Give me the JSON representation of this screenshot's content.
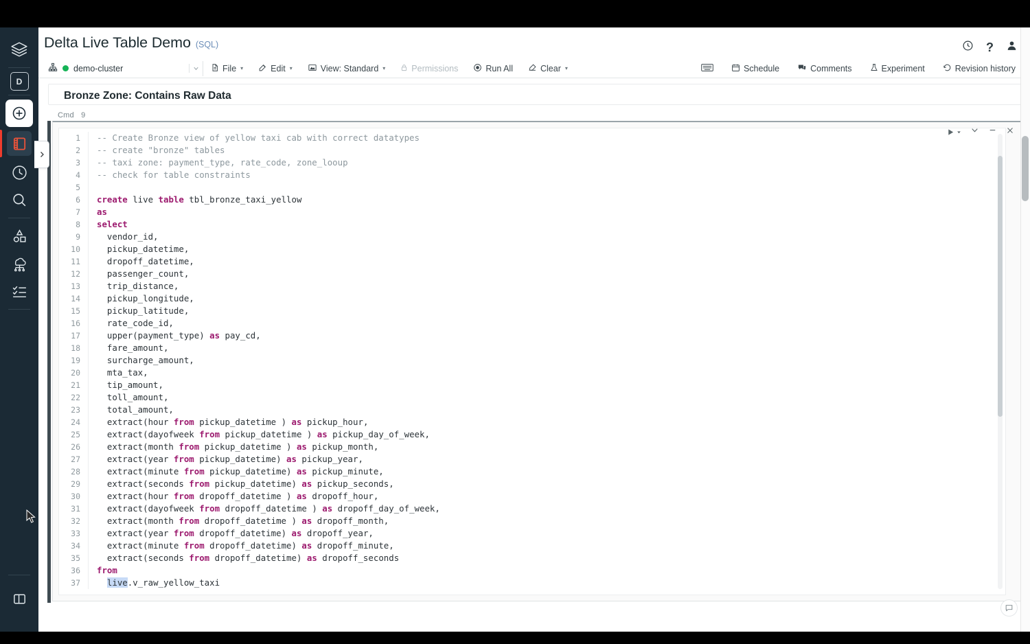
{
  "header": {
    "title": "Delta Live Table Demo",
    "language": "(SQL)",
    "icons": [
      "clock-icon",
      "help-icon",
      "account-icon"
    ]
  },
  "toolbar": {
    "cluster": {
      "name": "demo-cluster",
      "status": "running",
      "status_color": "#15b356"
    },
    "items": [
      {
        "label": "File",
        "icon": "file-icon",
        "caret": "▾",
        "disabled": false
      },
      {
        "label": "Edit",
        "icon": "edit-icon",
        "caret": "▾",
        "disabled": false
      },
      {
        "label": "View: Standard",
        "icon": "view-icon",
        "caret": "▾",
        "disabled": false
      },
      {
        "label": "Permissions",
        "icon": "lock-icon",
        "caret": "",
        "disabled": true
      },
      {
        "label": "Run All",
        "icon": "run-icon",
        "caret": "",
        "disabled": false
      },
      {
        "label": "Clear",
        "icon": "clear-icon",
        "caret": "▾",
        "disabled": false
      }
    ],
    "right_items": [
      {
        "label": "",
        "icon": "keyboard-icon"
      },
      {
        "label": "Schedule",
        "icon": "calendar-icon"
      },
      {
        "label": "Comments",
        "icon": "comments-icon"
      },
      {
        "label": "Experiment",
        "icon": "experiment-icon"
      },
      {
        "label": "Revision history",
        "icon": "revision-icon"
      }
    ]
  },
  "sidebar": {
    "items": [
      {
        "name": "logo-icon",
        "label": "Databricks"
      },
      {
        "name": "data-icon",
        "label": "D"
      },
      {
        "name": "create-icon",
        "label": "Create"
      },
      {
        "name": "notebook-icon",
        "label": "Workspace",
        "active": true
      },
      {
        "name": "recents-icon",
        "label": "Recents"
      },
      {
        "name": "search-icon",
        "label": "Search"
      },
      {
        "name": "models-icon",
        "label": "Models"
      },
      {
        "name": "compute-icon",
        "label": "Compute"
      },
      {
        "name": "jobs-icon",
        "label": "Jobs"
      }
    ],
    "bottom": {
      "name": "panel-toggle-icon",
      "label": "Toggle sidebar"
    },
    "expand_handle": "›"
  },
  "markdown_cell": {
    "heading": "Bronze Zone: Contains Raw Data"
  },
  "code_cell": {
    "cmd_label": "Cmd",
    "cmd_number": "9",
    "controls": [
      "run-icon",
      "chevron-down-icon",
      "minimize-icon",
      "close-icon"
    ],
    "selection_color": "#c7daf6",
    "keyword_color": "#9c1a6e",
    "comment_color": "#8d989e",
    "lines": [
      {
        "n": 1,
        "tokens": [
          {
            "t": "-- Create Bronze view of yellow taxi cab with correct datatypes",
            "c": "cm"
          }
        ]
      },
      {
        "n": 2,
        "tokens": [
          {
            "t": "-- create \"bronze\" tables",
            "c": "cm"
          }
        ]
      },
      {
        "n": 3,
        "tokens": [
          {
            "t": "-- taxi zone: payment_type, rate_code, zone_looup",
            "c": "cm"
          }
        ]
      },
      {
        "n": 4,
        "tokens": [
          {
            "t": "-- check for table constraints",
            "c": "cm"
          }
        ]
      },
      {
        "n": 5,
        "tokens": [
          {
            "t": "",
            "c": ""
          }
        ]
      },
      {
        "n": 6,
        "tokens": [
          {
            "t": "create",
            "c": "kw"
          },
          {
            "t": " live ",
            "c": ""
          },
          {
            "t": "table",
            "c": "kw"
          },
          {
            "t": " tbl_bronze_taxi_yellow",
            "c": ""
          }
        ]
      },
      {
        "n": 7,
        "tokens": [
          {
            "t": "as",
            "c": "kw"
          }
        ]
      },
      {
        "n": 8,
        "tokens": [
          {
            "t": "select",
            "c": "kw"
          }
        ]
      },
      {
        "n": 9,
        "tokens": [
          {
            "t": "  vendor_id,",
            "c": ""
          }
        ]
      },
      {
        "n": 10,
        "tokens": [
          {
            "t": "  pickup_datetime,",
            "c": ""
          }
        ]
      },
      {
        "n": 11,
        "tokens": [
          {
            "t": "  dropoff_datetime,",
            "c": ""
          }
        ]
      },
      {
        "n": 12,
        "tokens": [
          {
            "t": "  passenger_count,",
            "c": ""
          }
        ]
      },
      {
        "n": 13,
        "tokens": [
          {
            "t": "  trip_distance,",
            "c": ""
          }
        ]
      },
      {
        "n": 14,
        "tokens": [
          {
            "t": "  pickup_longitude,",
            "c": ""
          }
        ]
      },
      {
        "n": 15,
        "tokens": [
          {
            "t": "  pickup_latitude,",
            "c": ""
          }
        ]
      },
      {
        "n": 16,
        "tokens": [
          {
            "t": "  rate_code_id,",
            "c": ""
          }
        ]
      },
      {
        "n": 17,
        "tokens": [
          {
            "t": "  upper(payment_type) ",
            "c": ""
          },
          {
            "t": "as",
            "c": "kw"
          },
          {
            "t": " pay_cd,",
            "c": ""
          }
        ]
      },
      {
        "n": 18,
        "tokens": [
          {
            "t": "  fare_amount,",
            "c": ""
          }
        ]
      },
      {
        "n": 19,
        "tokens": [
          {
            "t": "  surcharge_amount,",
            "c": ""
          }
        ]
      },
      {
        "n": 20,
        "tokens": [
          {
            "t": "  mta_tax,",
            "c": ""
          }
        ]
      },
      {
        "n": 21,
        "tokens": [
          {
            "t": "  tip_amount,",
            "c": ""
          }
        ]
      },
      {
        "n": 22,
        "tokens": [
          {
            "t": "  toll_amount,",
            "c": ""
          }
        ]
      },
      {
        "n": 23,
        "tokens": [
          {
            "t": "  total_amount,",
            "c": ""
          }
        ]
      },
      {
        "n": 24,
        "tokens": [
          {
            "t": "  extract(hour ",
            "c": ""
          },
          {
            "t": "from",
            "c": "kw"
          },
          {
            "t": " pickup_datetime ) ",
            "c": ""
          },
          {
            "t": "as",
            "c": "kw"
          },
          {
            "t": " pickup_hour,",
            "c": ""
          }
        ]
      },
      {
        "n": 25,
        "tokens": [
          {
            "t": "  extract(dayofweek ",
            "c": ""
          },
          {
            "t": "from",
            "c": "kw"
          },
          {
            "t": " pickup_datetime ) ",
            "c": ""
          },
          {
            "t": "as",
            "c": "kw"
          },
          {
            "t": " pickup_day_of_week,",
            "c": ""
          }
        ]
      },
      {
        "n": 26,
        "tokens": [
          {
            "t": "  extract(month ",
            "c": ""
          },
          {
            "t": "from",
            "c": "kw"
          },
          {
            "t": " pickup_datetime ) ",
            "c": ""
          },
          {
            "t": "as",
            "c": "kw"
          },
          {
            "t": " pickup_month,",
            "c": ""
          }
        ]
      },
      {
        "n": 27,
        "tokens": [
          {
            "t": "  extract(year ",
            "c": ""
          },
          {
            "t": "from",
            "c": "kw"
          },
          {
            "t": " pickup_datetime) ",
            "c": ""
          },
          {
            "t": "as",
            "c": "kw"
          },
          {
            "t": " pickup_year,",
            "c": ""
          }
        ]
      },
      {
        "n": 28,
        "tokens": [
          {
            "t": "  extract(minute ",
            "c": ""
          },
          {
            "t": "from",
            "c": "kw"
          },
          {
            "t": " pickup_datetime) ",
            "c": ""
          },
          {
            "t": "as",
            "c": "kw"
          },
          {
            "t": " pickup_minute,",
            "c": ""
          }
        ]
      },
      {
        "n": 29,
        "tokens": [
          {
            "t": "  extract(seconds ",
            "c": ""
          },
          {
            "t": "from",
            "c": "kw"
          },
          {
            "t": " pickup_datetime) ",
            "c": ""
          },
          {
            "t": "as",
            "c": "kw"
          },
          {
            "t": " pickup_seconds,",
            "c": ""
          }
        ]
      },
      {
        "n": 30,
        "tokens": [
          {
            "t": "  extract(hour ",
            "c": ""
          },
          {
            "t": "from",
            "c": "kw"
          },
          {
            "t": " dropoff_datetime ) ",
            "c": ""
          },
          {
            "t": "as",
            "c": "kw"
          },
          {
            "t": " dropoff_hour,",
            "c": ""
          }
        ]
      },
      {
        "n": 31,
        "tokens": [
          {
            "t": "  extract(dayofweek ",
            "c": ""
          },
          {
            "t": "from",
            "c": "kw"
          },
          {
            "t": " dropoff_datetime ) ",
            "c": ""
          },
          {
            "t": "as",
            "c": "kw"
          },
          {
            "t": " dropoff_day_of_week,",
            "c": ""
          }
        ]
      },
      {
        "n": 32,
        "tokens": [
          {
            "t": "  extract(month ",
            "c": ""
          },
          {
            "t": "from",
            "c": "kw"
          },
          {
            "t": " dropoff_datetime ) ",
            "c": ""
          },
          {
            "t": "as",
            "c": "kw"
          },
          {
            "t": " dropoff_month,",
            "c": ""
          }
        ]
      },
      {
        "n": 33,
        "tokens": [
          {
            "t": "  extract(year ",
            "c": ""
          },
          {
            "t": "from",
            "c": "kw"
          },
          {
            "t": " dropoff_datetime) ",
            "c": ""
          },
          {
            "t": "as",
            "c": "kw"
          },
          {
            "t": " dropoff_year,",
            "c": ""
          }
        ]
      },
      {
        "n": 34,
        "tokens": [
          {
            "t": "  extract(minute ",
            "c": ""
          },
          {
            "t": "from",
            "c": "kw"
          },
          {
            "t": " dropoff_datetime) ",
            "c": ""
          },
          {
            "t": "as",
            "c": "kw"
          },
          {
            "t": " dropoff_minute,",
            "c": ""
          }
        ]
      },
      {
        "n": 35,
        "tokens": [
          {
            "t": "  extract(seconds ",
            "c": ""
          },
          {
            "t": "from",
            "c": "kw"
          },
          {
            "t": " dropoff_datetime) ",
            "c": ""
          },
          {
            "t": "as",
            "c": "kw"
          },
          {
            "t": " dropoff_seconds",
            "c": ""
          }
        ]
      },
      {
        "n": 36,
        "tokens": [
          {
            "t": "from",
            "c": "kw"
          }
        ]
      },
      {
        "n": 37,
        "tokens": [
          {
            "t": "  ",
            "c": ""
          },
          {
            "t": "live",
            "c": "sel"
          },
          {
            "t": ".v_raw_yellow_taxi",
            "c": ""
          }
        ]
      }
    ]
  },
  "comment_fab": {
    "icon": "comment-bubble-icon"
  }
}
